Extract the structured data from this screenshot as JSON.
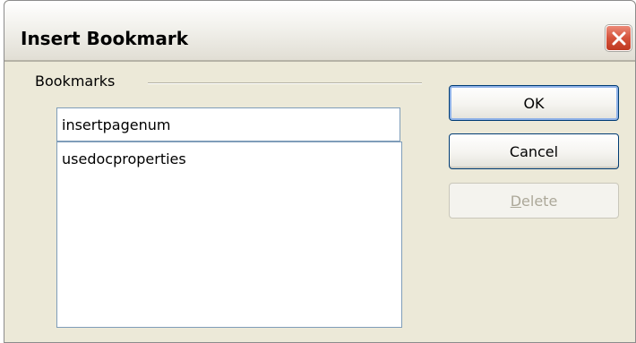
{
  "window": {
    "title": "Insert Bookmark"
  },
  "bookmarks_group": {
    "label": "Bookmarks",
    "name_value": "insertpagenum",
    "items": [
      "usedocproperties"
    ]
  },
  "buttons": {
    "ok_label": "OK",
    "cancel_label": "Cancel",
    "delete_label_mnemonic": "D",
    "delete_label_rest": "elete"
  },
  "icons": {
    "close": "close-x-icon"
  },
  "colors": {
    "dialog_bg": "#ece9d8",
    "close_button": "#d5533b",
    "input_border": "#7f9db9",
    "button_border": "#003c74"
  }
}
